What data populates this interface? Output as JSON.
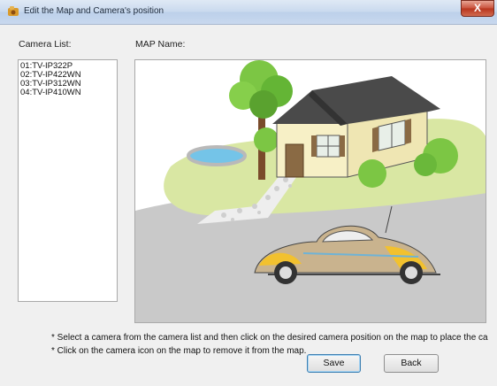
{
  "window": {
    "title": "Edit the Map and Camera's position",
    "close_glyph": "X"
  },
  "camera_list": {
    "label": "Camera List:",
    "items": [
      "01:TV-IP322P",
      "02:TV-IP422WN",
      "03:TV-IP312WN",
      "04:TV-IP410WN"
    ]
  },
  "map": {
    "label": "MAP Name:",
    "image_description": "house-with-car-illustration"
  },
  "notes": [
    "* Select a camera from the camera list and then click on the desired camera position on the map to place the ca",
    "* Click on the camera icon on the map to remove it from the map."
  ],
  "buttons": {
    "save": "Save",
    "back": "Back"
  },
  "colors": {
    "title_bar": "#c9d9ee",
    "close_button": "#c8513b",
    "house_wall": "#f7f0c6",
    "roof": "#4a4a4a",
    "lawn": "#d6e59b",
    "tree": "#6fbf3a",
    "road": "#c6c6c6",
    "car_body": "#c9b38e",
    "car_accent": "#f2c12e",
    "pool": "#74c4e8"
  }
}
